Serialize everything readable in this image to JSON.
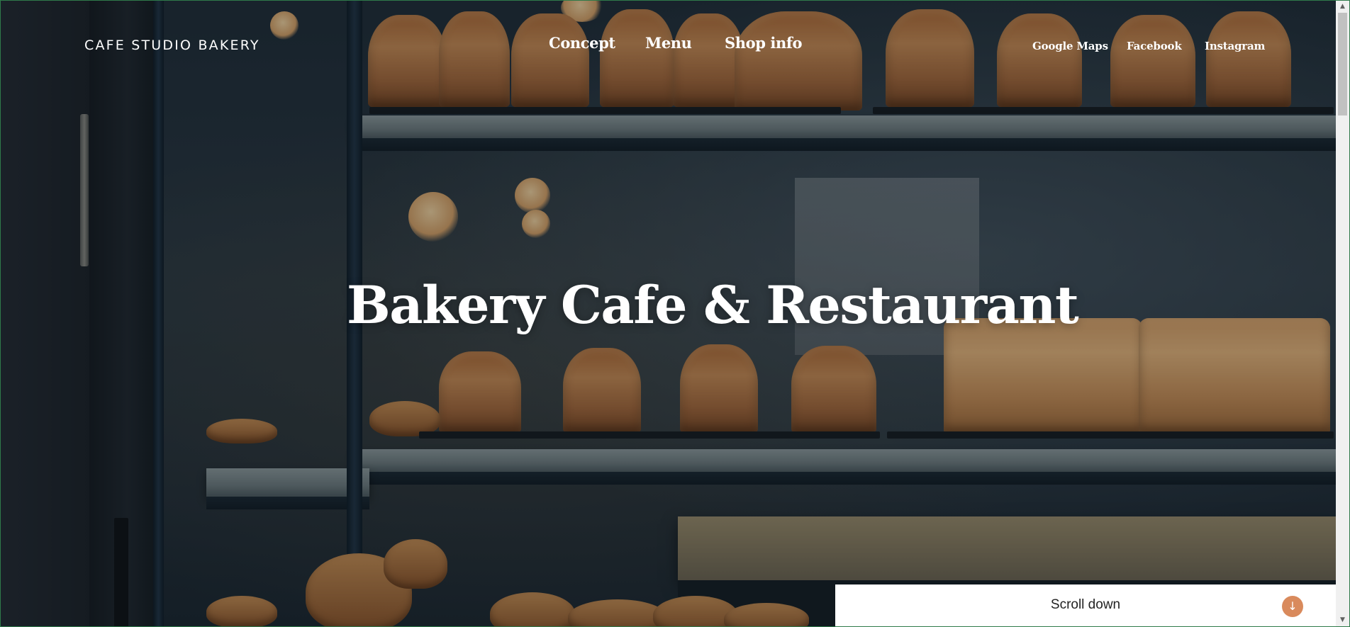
{
  "header": {
    "brand": "CAFE STUDIO BAKERY",
    "nav": [
      {
        "label": "Concept"
      },
      {
        "label": "Menu"
      },
      {
        "label": "Shop info"
      }
    ],
    "social": [
      {
        "label": "Google Maps"
      },
      {
        "label": "Facebook"
      },
      {
        "label": "Instagram"
      }
    ]
  },
  "hero": {
    "title": "Bakery Cafe & Restaurant",
    "background": "photo of bread loaves on bakery display shelves"
  },
  "scroll_down": {
    "label": "Scroll down",
    "icon": "arrow-down-icon",
    "icon_glyph": "↓",
    "accent": "#d98a5c"
  },
  "scrollbar": {
    "up_glyph": "▲",
    "down_glyph": "▼"
  },
  "colors": {
    "text": "#ffffff",
    "scroll_bar_bg": "#ffffff",
    "accent": "#d98a5c"
  }
}
